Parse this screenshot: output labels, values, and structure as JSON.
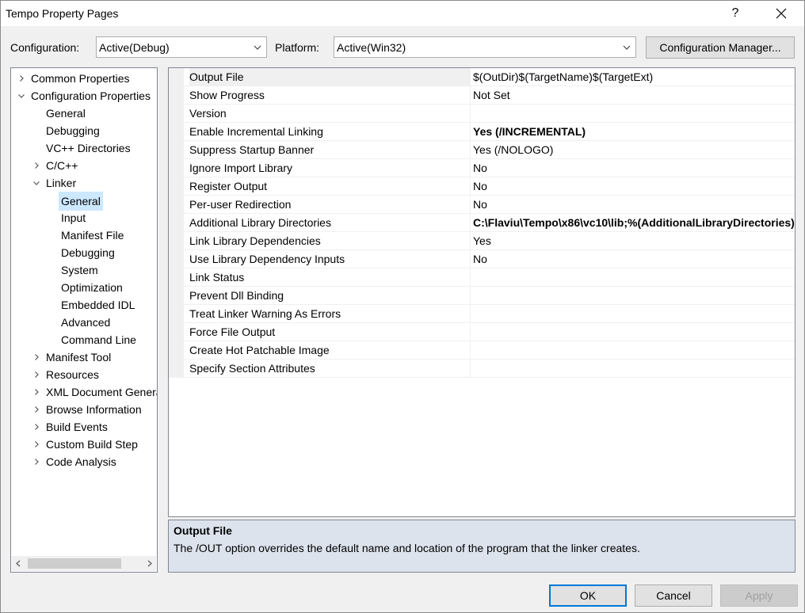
{
  "window": {
    "title": "Tempo Property Pages",
    "help_label": "?"
  },
  "config": {
    "configuration_label": "Configuration:",
    "configuration_value": "Active(Debug)",
    "platform_label": "Platform:",
    "platform_value": "Active(Win32)",
    "manager_label": "Configuration Manager..."
  },
  "tree": {
    "items": [
      {
        "label": "Common Properties"
      },
      {
        "label": "Configuration Properties"
      },
      {
        "label": "General"
      },
      {
        "label": "Debugging"
      },
      {
        "label": "VC++ Directories"
      },
      {
        "label": "C/C++"
      },
      {
        "label": "Linker"
      },
      {
        "label": "General"
      },
      {
        "label": "Input"
      },
      {
        "label": "Manifest File"
      },
      {
        "label": "Debugging"
      },
      {
        "label": "System"
      },
      {
        "label": "Optimization"
      },
      {
        "label": "Embedded IDL"
      },
      {
        "label": "Advanced"
      },
      {
        "label": "Command Line"
      },
      {
        "label": "Manifest Tool"
      },
      {
        "label": "Resources"
      },
      {
        "label": "XML Document Generator"
      },
      {
        "label": "Browse Information"
      },
      {
        "label": "Build Events"
      },
      {
        "label": "Custom Build Step"
      },
      {
        "label": "Code Analysis"
      }
    ]
  },
  "grid": {
    "rows": [
      {
        "name": "Output File",
        "value": "$(OutDir)$(TargetName)$(TargetExt)"
      },
      {
        "name": "Show Progress",
        "value": "Not Set"
      },
      {
        "name": "Version",
        "value": ""
      },
      {
        "name": "Enable Incremental Linking",
        "value": "Yes (/INCREMENTAL)"
      },
      {
        "name": "Suppress Startup Banner",
        "value": "Yes (/NOLOGO)"
      },
      {
        "name": "Ignore Import Library",
        "value": "No"
      },
      {
        "name": "Register Output",
        "value": "No"
      },
      {
        "name": "Per-user Redirection",
        "value": "No"
      },
      {
        "name": "Additional Library Directories",
        "value": "C:\\Flaviu\\Tempo\\x86\\vc10\\lib;%(AdditionalLibraryDirectories)"
      },
      {
        "name": "Link Library Dependencies",
        "value": "Yes"
      },
      {
        "name": "Use Library Dependency Inputs",
        "value": "No"
      },
      {
        "name": "Link Status",
        "value": ""
      },
      {
        "name": "Prevent Dll Binding",
        "value": ""
      },
      {
        "name": "Treat Linker Warning As Errors",
        "value": ""
      },
      {
        "name": "Force File Output",
        "value": ""
      },
      {
        "name": "Create Hot Patchable Image",
        "value": ""
      },
      {
        "name": "Specify Section Attributes",
        "value": ""
      }
    ]
  },
  "description": {
    "title": "Output File",
    "text": "The /OUT option overrides the default name and location of the program that the linker creates."
  },
  "buttons": {
    "ok": "OK",
    "cancel": "Cancel",
    "apply": "Apply"
  }
}
